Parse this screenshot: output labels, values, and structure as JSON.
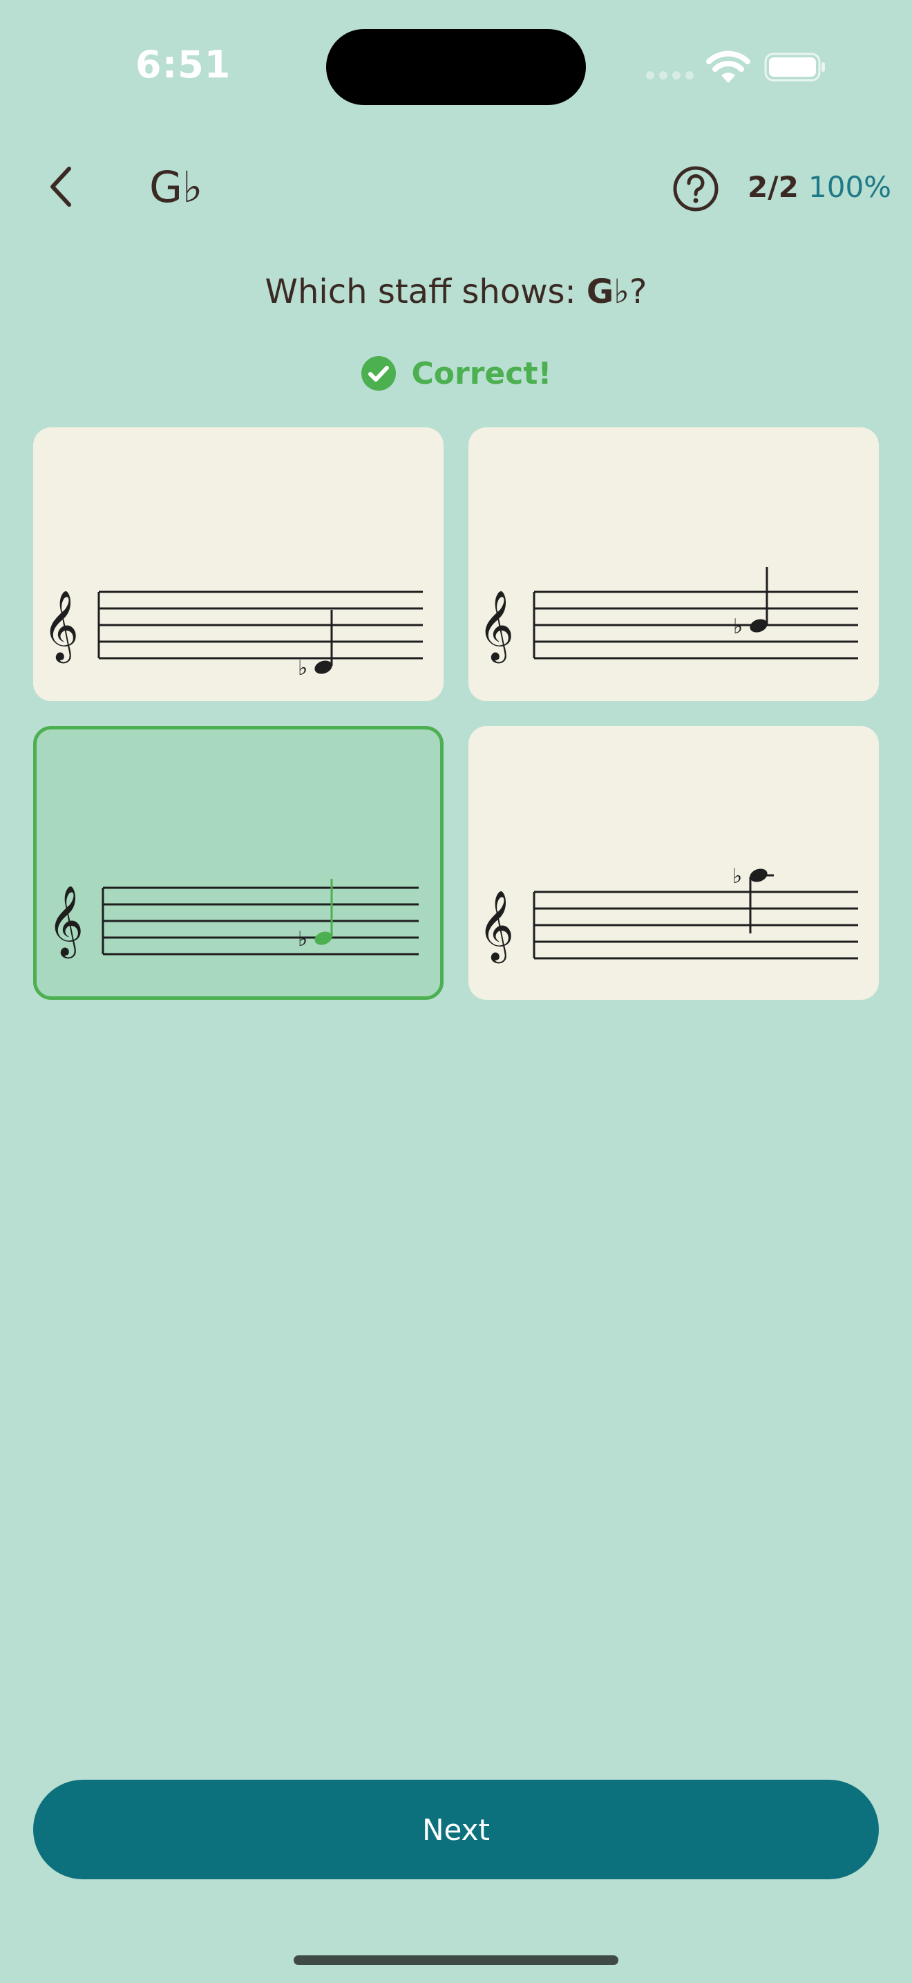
{
  "status": {
    "time": "6:51"
  },
  "nav": {
    "title": "G♭",
    "score": "2/2",
    "percent": "100%"
  },
  "question": {
    "prefix": "Which staff shows: ",
    "note": "G♭",
    "suffix": "?"
  },
  "feedback": {
    "text": "Correct!"
  },
  "options": [
    {
      "id": "option-1",
      "state": "default"
    },
    {
      "id": "option-2",
      "state": "default"
    },
    {
      "id": "option-3",
      "state": "correct-selected"
    },
    {
      "id": "option-4",
      "state": "default"
    }
  ],
  "footer": {
    "next_label": "Next"
  },
  "colors": {
    "background": "#b9ded2",
    "card": "#f3f0e4",
    "correct": "#4caf50",
    "selected_card": "#a8d8bd",
    "primary_button": "#0d717d",
    "percent": "#1e7a86",
    "text": "#3b2a24"
  }
}
